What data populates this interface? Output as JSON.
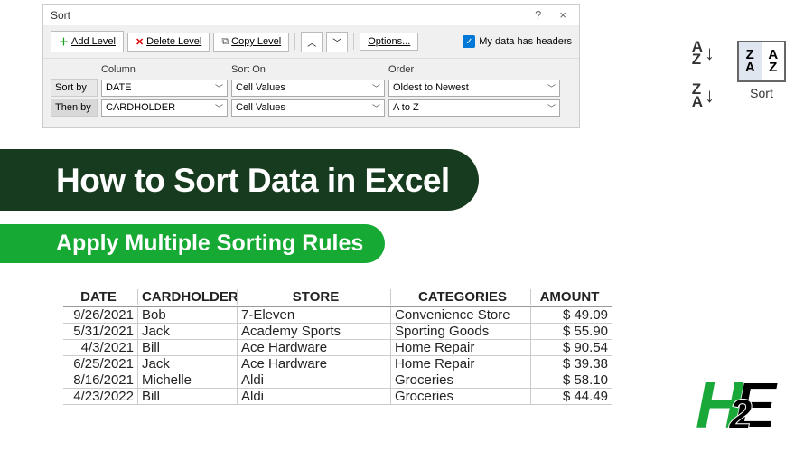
{
  "dialog": {
    "title": "Sort",
    "help": "?",
    "close": "×",
    "add_level": "Add Level",
    "delete_level": "Delete Level",
    "copy_level": "Copy Level",
    "options": "Options...",
    "headers_label": "My data has headers",
    "col_header": "Column",
    "sorton_header": "Sort On",
    "order_header": "Order",
    "rows": [
      {
        "label": "Sort by",
        "column": "DATE",
        "sorton": "Cell Values",
        "order": "Oldest to Newest"
      },
      {
        "label": "Then by",
        "column": "CARDHOLDER",
        "sorton": "Cell Values",
        "order": "A to Z"
      }
    ]
  },
  "ribbon": {
    "sort_label": "Sort",
    "az_a": "A",
    "az_z": "Z"
  },
  "banner": {
    "title": "How to Sort Data in Excel",
    "subtitle": "Apply Multiple Sorting Rules"
  },
  "table": {
    "headers": {
      "date": "DATE",
      "cardholder": "CARDHOLDER",
      "store": "STORE",
      "categories": "CATEGORIES",
      "amount": "AMOUNT"
    },
    "rows": [
      {
        "date": "9/26/2021",
        "cardholder": "Bob",
        "store": "7-Eleven",
        "categories": "Convenience Store",
        "amount": "$  49.09"
      },
      {
        "date": "5/31/2021",
        "cardholder": "Jack",
        "store": "Academy Sports",
        "categories": "Sporting Goods",
        "amount": "$  55.90"
      },
      {
        "date": "4/3/2021",
        "cardholder": "Bill",
        "store": "Ace Hardware",
        "categories": "Home Repair",
        "amount": "$  90.54"
      },
      {
        "date": "6/25/2021",
        "cardholder": "Jack",
        "store": "Ace Hardware",
        "categories": "Home Repair",
        "amount": "$  39.38"
      },
      {
        "date": "8/16/2021",
        "cardholder": "Michelle",
        "store": "Aldi",
        "categories": "Groceries",
        "amount": "$  58.10"
      },
      {
        "date": "4/23/2022",
        "cardholder": "Bill",
        "store": "Aldi",
        "categories": "Groceries",
        "amount": "$  44.49"
      }
    ]
  }
}
